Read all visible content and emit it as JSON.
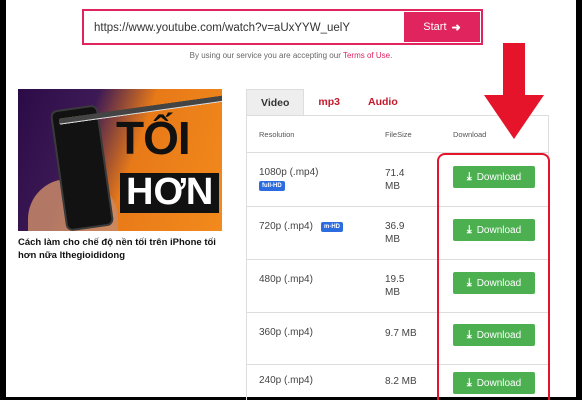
{
  "search": {
    "url_value": "https://www.youtube.com/watch?v=aUxYYW_uelY",
    "start_label": "Start"
  },
  "terms": {
    "prefix": "By using our service you are accepting our ",
    "link": "Terms of Use",
    "suffix": "."
  },
  "video": {
    "thumbnail_line1": "TỐI",
    "thumbnail_line2": "HƠN",
    "title": "Cách làm cho chế độ nền tối trên iPhone tối hơn nữa lthegioididong"
  },
  "tabs": [
    {
      "label": "Video",
      "active": true
    },
    {
      "label": "mp3",
      "active": false
    },
    {
      "label": "Audio",
      "active": false
    }
  ],
  "table": {
    "headers": {
      "resolution": "Resolution",
      "filesize": "FileSize",
      "download": "Download"
    },
    "rows": [
      {
        "resolution": "1080p (.mp4)",
        "badge": "full-HD",
        "size_line1": "71.4",
        "size_line2": "MB",
        "button": "Download"
      },
      {
        "resolution": "720p (.mp4)",
        "badge": "m-HD",
        "size_line1": "36.9",
        "size_line2": "MB",
        "button": "Download"
      },
      {
        "resolution": "480p (.mp4)",
        "badge": "",
        "size_line1": "19.5",
        "size_line2": "MB",
        "button": "Download"
      },
      {
        "resolution": "360p (.mp4)",
        "badge": "",
        "size_line1": "9.7 MB",
        "size_line2": "",
        "button": "Download"
      },
      {
        "resolution": "240p (.mp4)",
        "badge": "",
        "size_line1": "8.2 MB",
        "size_line2": "",
        "button": "Download"
      }
    ]
  },
  "colors": {
    "accent": "#e0245e",
    "download_green": "#4caf50",
    "badge_blue": "#2d6cdf",
    "annotation_red": "#e5142a"
  },
  "icons": {
    "start": "arrow-right-icon",
    "download": "download-icon",
    "annotation": "big-red-down-arrow"
  }
}
